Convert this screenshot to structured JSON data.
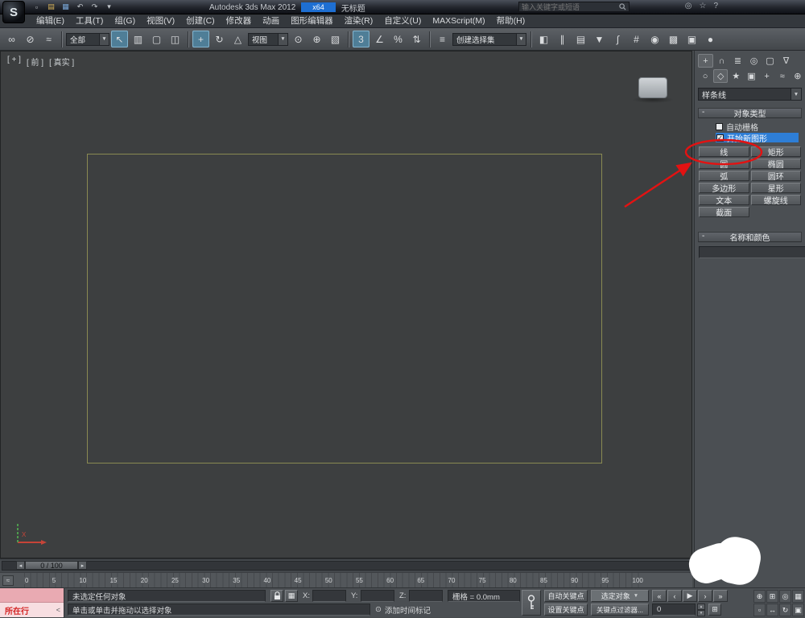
{
  "titlebar": {
    "app_title": "Autodesk 3ds Max 2012",
    "edition_chip": "x64",
    "doc_title": "无标题",
    "search_placeholder": "输入关键字或短语"
  },
  "menubar": {
    "items": [
      "编辑(E)",
      "工具(T)",
      "组(G)",
      "视图(V)",
      "创建(C)",
      "修改器",
      "动画",
      "图形编辑器",
      "渲染(R)",
      "自定义(U)",
      "MAXScript(M)",
      "帮助(H)"
    ]
  },
  "toolbar": {
    "selection_filter_value": "全部",
    "reference_coordinate_value": "视图",
    "named_selection_value": "创建选择集"
  },
  "viewport": {
    "label_expand": "[ + ]",
    "label_view": "[ 前 ]",
    "label_shading": "[ 真实 ]"
  },
  "command_panel": {
    "category_value": "样条线",
    "object_type_rollout": "对象类型",
    "autogrid_label": "自动栅格",
    "autogrid_checked": false,
    "start_new_shape_label": "开始新图形",
    "start_new_shape_checked": true,
    "shape_buttons": [
      "线",
      "矩形",
      "圆",
      "椭圆",
      "弧",
      "圆环",
      "多边形",
      "星形",
      "文本",
      "螺旋线",
      "截面"
    ],
    "name_color_rollout": "名称和颜色",
    "name_value": ""
  },
  "timeline": {
    "slider_value": "0 / 100",
    "ticks": [
      "0",
      "5",
      "10",
      "15",
      "20",
      "25",
      "30",
      "35",
      "40",
      "45",
      "50",
      "55",
      "60",
      "65",
      "70",
      "75",
      "80",
      "85",
      "90",
      "95",
      "100"
    ]
  },
  "statusbar": {
    "listener_text": "所在行",
    "listener_expand": "<",
    "status_text": "未选定任何对象",
    "prompt_text": "单击或单击并拖动以选择对象",
    "add_time_tag": "添加时间标记",
    "x_label": "X:",
    "y_label": "Y:",
    "z_label": "Z:",
    "x_value": "",
    "y_value": "",
    "z_value": "",
    "grid_text": "栅格 = 0.0mm",
    "auto_key": "自动关键点",
    "set_key": "设置关键点",
    "selected_filter": "选定对象",
    "key_filters": "关键点过滤器...",
    "frame_value": "0"
  },
  "colors": {
    "accent_blue": "#2e7ed6",
    "annotation_red": "#e31212",
    "active_tool_teal": "#4f7e97",
    "spline_olive": "#8a8a52"
  },
  "icons": {
    "logo": "S",
    "new_doc": "▫",
    "open": "▤",
    "save": "▦",
    "undo": "↶",
    "redo": "↷",
    "caret": "▾",
    "star": "☆",
    "help": "?",
    "globe": "◎",
    "link": "∞",
    "unlink": "⊘",
    "bind": "≈",
    "select": "↖",
    "select_by_name": "▥",
    "region": "▢",
    "crossing": "◫",
    "move": "+",
    "rotate": "↻",
    "scale": "△",
    "pivot": "⊙",
    "manipulate": "⊕",
    "keyboard": "▧",
    "snap": "3",
    "angle_snap": "∠",
    "percent_snap": "%",
    "spinner_snap": "⇅",
    "named_sets": "≡",
    "mirror": "◧",
    "align": "∥",
    "layers": "▤",
    "ribbon": "▼",
    "curve_editor": "∫",
    "schematic": "#",
    "material": "◉",
    "render_setup": "▩",
    "render_frame": "▣",
    "render": "●",
    "tab_create": "+",
    "tab_modify": "∩",
    "tab_hierarchy": "≣",
    "tab_motion": "◎",
    "tab_display": "▢",
    "tab_utility": "∇",
    "sub_geometry": "○",
    "sub_shapes": "◇",
    "sub_lights": "★",
    "sub_cameras": "▣",
    "sub_helpers": "+",
    "sub_spacewarps": "≈",
    "sub_systems": "⊕",
    "collapse": "-",
    "check": "✓",
    "dropdown": "▼",
    "slider_prev": "◂",
    "slider_next": "▸",
    "mini_curve": "≈",
    "go_start": "«",
    "prev_frame": "‹",
    "play": "▶",
    "next_frame": "›",
    "go_end": "»",
    "spin_up": "▴",
    "spin_down": "▾",
    "time_config": "⊞",
    "abs_toggle": "▦",
    "clock": "⊙",
    "nav_zoom": "⊕",
    "nav_zoom_all": "⊞",
    "nav_extents": "◎",
    "nav_extents_all": "▦",
    "nav_region": "▫",
    "nav_pan": "↔",
    "nav_orbit": "↻",
    "nav_maximize": "▣"
  }
}
